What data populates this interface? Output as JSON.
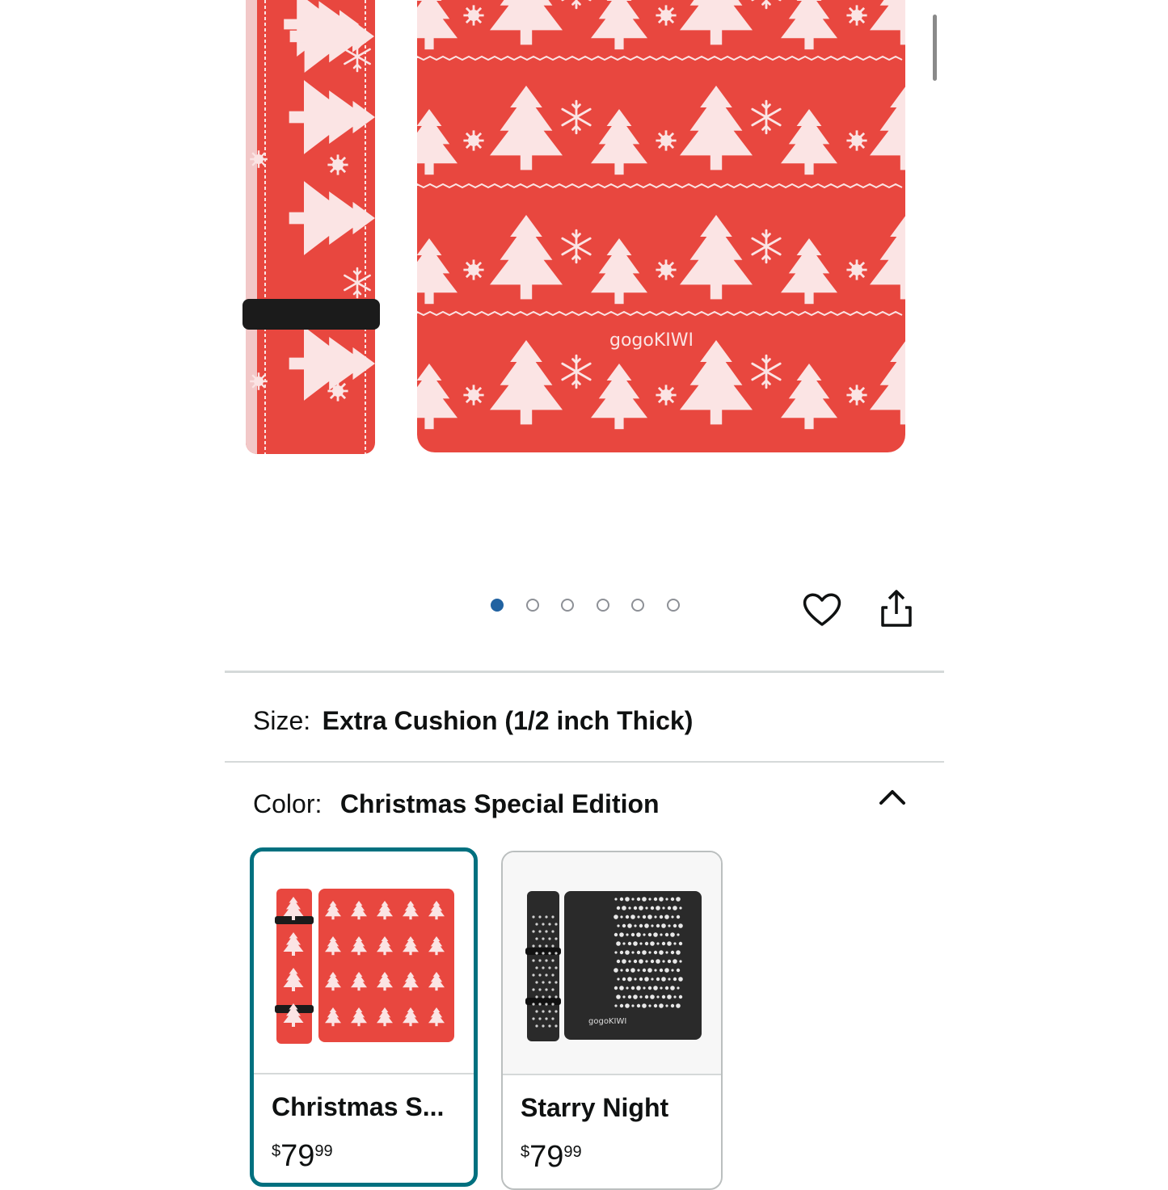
{
  "hero": {
    "brand_mark": "gogoKIWI",
    "carousel": {
      "total": 6,
      "active_index": 0
    }
  },
  "size_row": {
    "label": "Size:",
    "value": "Extra Cushion (1/2 inch Thick)"
  },
  "color_row": {
    "label": "Color:",
    "value": "Christmas Special Edition",
    "expanded": true
  },
  "swatches": [
    {
      "name": "Christmas S...",
      "currency": "$",
      "price_whole": "79",
      "price_fraction": "99",
      "selected": true
    },
    {
      "name": "Starry Night",
      "currency": "$",
      "price_whole": "79",
      "price_fraction": "99",
      "selected": false
    }
  ],
  "icons": {
    "wishlist": "heart-icon",
    "share": "share-icon",
    "collapse": "chevron-up-icon"
  },
  "colors": {
    "accent_selected": "#00707f",
    "dot_active": "#2162a1",
    "mat_red": "#e8473f",
    "mat_black": "#2a2a2a"
  }
}
